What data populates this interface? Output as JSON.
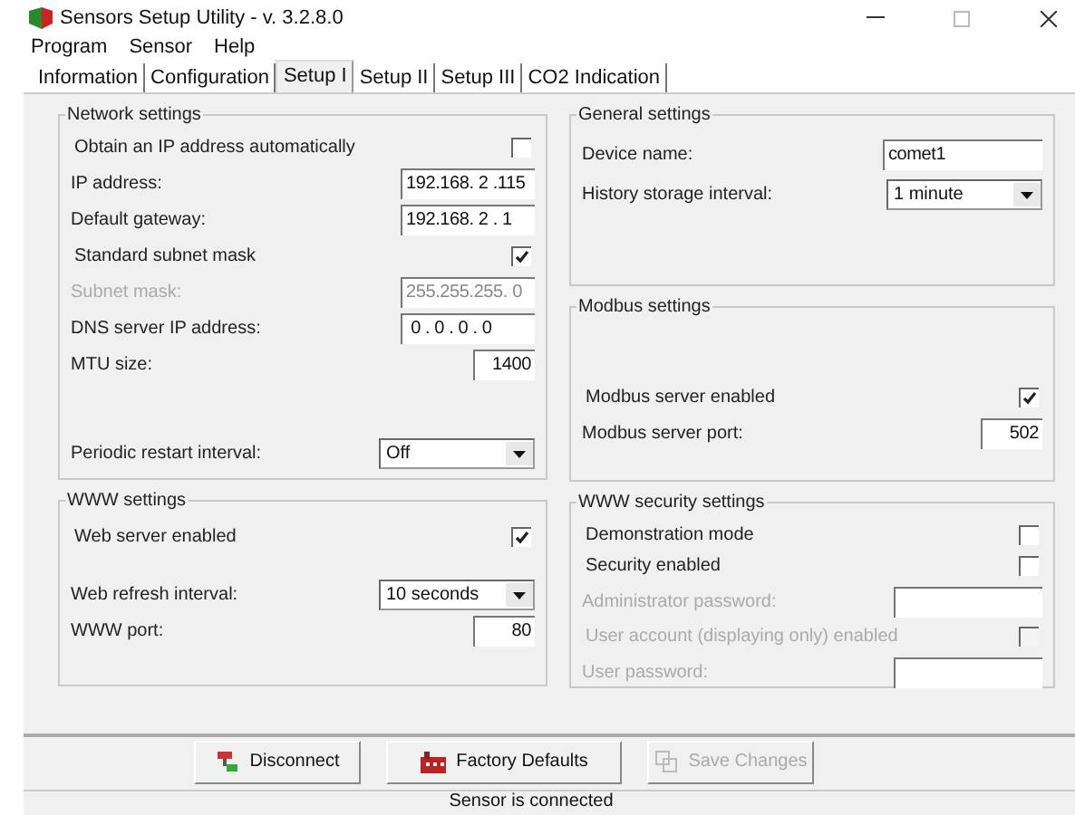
{
  "window": {
    "title": "Sensors Setup Utility - v. 3.2.8.0"
  },
  "menu": [
    "Program",
    "Sensor",
    "Help"
  ],
  "tabs": [
    {
      "label": "Information",
      "selected": false
    },
    {
      "label": "Configuration",
      "selected": false
    },
    {
      "label": "Setup I",
      "selected": true
    },
    {
      "label": "Setup II",
      "selected": false
    },
    {
      "label": "Setup III",
      "selected": false
    },
    {
      "label": "CO2 Indication",
      "selected": false
    }
  ],
  "columns": [
    {
      "groups": [
        {
          "title": "Network settings",
          "rows": [
            {
              "kind": "checkbox",
              "label": "Obtain an IP address automatically",
              "checked": false,
              "disabled": false
            },
            {
              "kind": "ip",
              "label": "IP address:",
              "value": "192.168. 2 .115",
              "disabled": false
            },
            {
              "kind": "ip",
              "label": "Default gateway:",
              "value": "192.168. 2 . 1",
              "disabled": false
            },
            {
              "kind": "checkbox",
              "label": "Standard subnet mask",
              "checked": true,
              "disabled": false
            },
            {
              "kind": "ip",
              "label": "Subnet mask:",
              "value": "255.255.255. 0",
              "disabled": true
            },
            {
              "kind": "ip",
              "label": "DNS server IP address:",
              "value": " 0 . 0 . 0 . 0",
              "disabled": false
            },
            {
              "kind": "number",
              "label": "MTU size:",
              "value": "1400",
              "disabled": false
            },
            {
              "kind": "select",
              "label": "Periodic restart interval:",
              "value": "Off",
              "disabled": false
            }
          ]
        },
        {
          "title": "WWW settings",
          "rows": [
            {
              "kind": "checkbox",
              "label": "Web server enabled",
              "checked": true,
              "disabled": false
            },
            {
              "kind": "select",
              "label": "Web refresh interval:",
              "value": "10 seconds",
              "disabled": false
            },
            {
              "kind": "number",
              "label": "WWW port:",
              "value": "80",
              "disabled": false
            }
          ]
        }
      ]
    },
    {
      "groups": [
        {
          "title": "General settings",
          "rows": [
            {
              "kind": "text",
              "label": "Device name:",
              "value": "comet1",
              "disabled": false
            },
            {
              "kind": "select",
              "label": "History storage interval:",
              "value": "1 minute",
              "disabled": false
            }
          ]
        },
        {
          "title": "Modbus settings",
          "rows": [
            {
              "kind": "checkbox",
              "label": "Modbus server enabled",
              "checked": true,
              "disabled": false
            },
            {
              "kind": "number",
              "label": "Modbus server port:",
              "value": "502",
              "disabled": false
            }
          ]
        },
        {
          "title": "WWW security settings",
          "rows": [
            {
              "kind": "checkbox",
              "label": "Demonstration mode",
              "checked": false,
              "disabled": false
            },
            {
              "kind": "checkbox",
              "label": "Security enabled",
              "checked": false,
              "disabled": false
            },
            {
              "kind": "password",
              "label": "Administrator password:",
              "disabled": true
            },
            {
              "kind": "checkbox",
              "label": "User account (displaying only) enabled",
              "checked": false,
              "disabled": true
            },
            {
              "kind": "password",
              "label": "User password:",
              "disabled": true
            }
          ]
        }
      ]
    }
  ],
  "buttons": [
    {
      "kind": "disconnect",
      "label": "Disconnect",
      "disabled": false
    },
    {
      "kind": "factory",
      "label": "Factory Defaults",
      "disabled": false
    },
    {
      "kind": "save",
      "label": "Save Changes",
      "disabled": true
    }
  ],
  "status_bar": "Sensor is connected"
}
